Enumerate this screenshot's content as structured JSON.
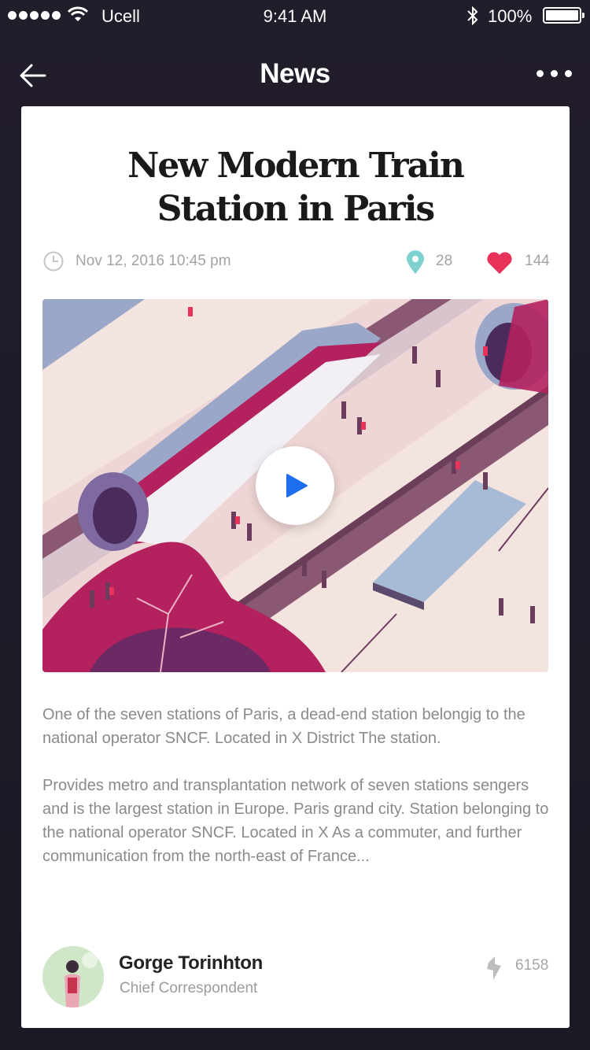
{
  "status_bar": {
    "carrier": "Ucell",
    "time": "9:41 AM",
    "battery": "100%"
  },
  "nav": {
    "title": "News",
    "back_icon": "arrow-left-icon",
    "more_icon": "more-horizontal-icon"
  },
  "article": {
    "title_line1": "New Modern Train",
    "title_line2": "Station in Paris",
    "date": "Nov 12, 2016 10:45 pm",
    "location_count": "28",
    "like_count": "144",
    "paragraph1": "One of the seven stations of Paris, a dead-end station belongig to the national operator SNCF. Located in X District The station.",
    "paragraph2": "Provides metro and transplantation network of seven stations sengers and is the largest station in Europe. Paris grand city. Station belonging to the national operator SNCF. Located in X As a commuter, and further communication from the north-east of France..."
  },
  "author": {
    "name": "Gorge Torinhton",
    "role": "Chief Correspondent",
    "share_count": "6158"
  },
  "colors": {
    "background": "#1f1b27",
    "card": "#ffffff",
    "heart": "#e8325a",
    "pin": "#7fd1cf",
    "play": "#1e6ff0"
  }
}
